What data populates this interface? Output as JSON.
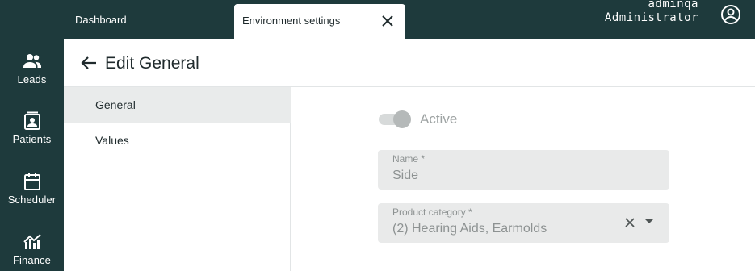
{
  "nav_rail": {
    "items": [
      {
        "label": "Leads",
        "icon": "people-icon"
      },
      {
        "label": "Patients",
        "icon": "contact-card-icon"
      },
      {
        "label": "Scheduler",
        "icon": "calendar-icon"
      },
      {
        "label": "Finance",
        "icon": "chart-trend-icon"
      }
    ]
  },
  "topbar": {
    "tabs": [
      {
        "label": "Dashboard"
      },
      {
        "label": "Environment settings"
      }
    ],
    "user": {
      "username": "adminqa",
      "role": "Administrator"
    }
  },
  "header": {
    "title": "Edit General"
  },
  "sidenav": {
    "items": [
      {
        "label": "General"
      },
      {
        "label": "Values"
      }
    ]
  },
  "form": {
    "active_label": "Active",
    "active_on": true,
    "name": {
      "label": "Name *",
      "value": "Side"
    },
    "product_category": {
      "label": "Product category *",
      "value": "(2) Hearing Aids, Earmolds"
    }
  },
  "colors": {
    "rail_bg": "#1e3a3c",
    "selected_nav_bg": "#e9ebeb",
    "field_bg": "#e9eaea"
  }
}
